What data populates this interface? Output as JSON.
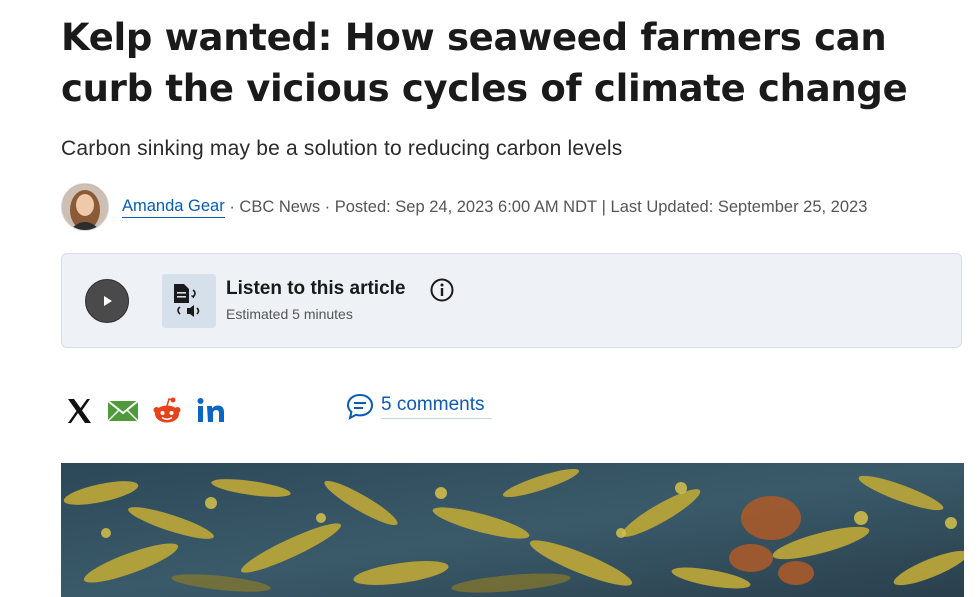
{
  "article": {
    "headline": "Kelp wanted: How seaweed farmers can curb the vicious cycles of climate change",
    "dek": "Carbon sinking may be a solution to reducing carbon levels",
    "byline": {
      "author": "Amanda Gear",
      "source": " · CBC News · ",
      "posted": "Posted: Sep 24, 2023 6:00 AM NDT",
      "separator": " | ",
      "updated": "Last Updated: September 25, 2023"
    }
  },
  "audio_player": {
    "title": "Listen to this article",
    "estimate": "Estimated 5 minutes",
    "play_icon": "play-icon",
    "tts_icon": "text-to-speech-icon",
    "info_icon": "info-icon"
  },
  "share": {
    "icons": [
      "x-icon",
      "email-icon",
      "reddit-icon",
      "linkedin-icon"
    ],
    "comments_label": "5 comments"
  },
  "hero_image": {
    "subject": "seaweed"
  },
  "colors": {
    "link": "#0b5bb0",
    "audio_bg": "#eef2f6",
    "email_green": "#4f9a3c",
    "reddit_orange": "#e8421a",
    "linkedin_blue": "#0a66c2"
  }
}
